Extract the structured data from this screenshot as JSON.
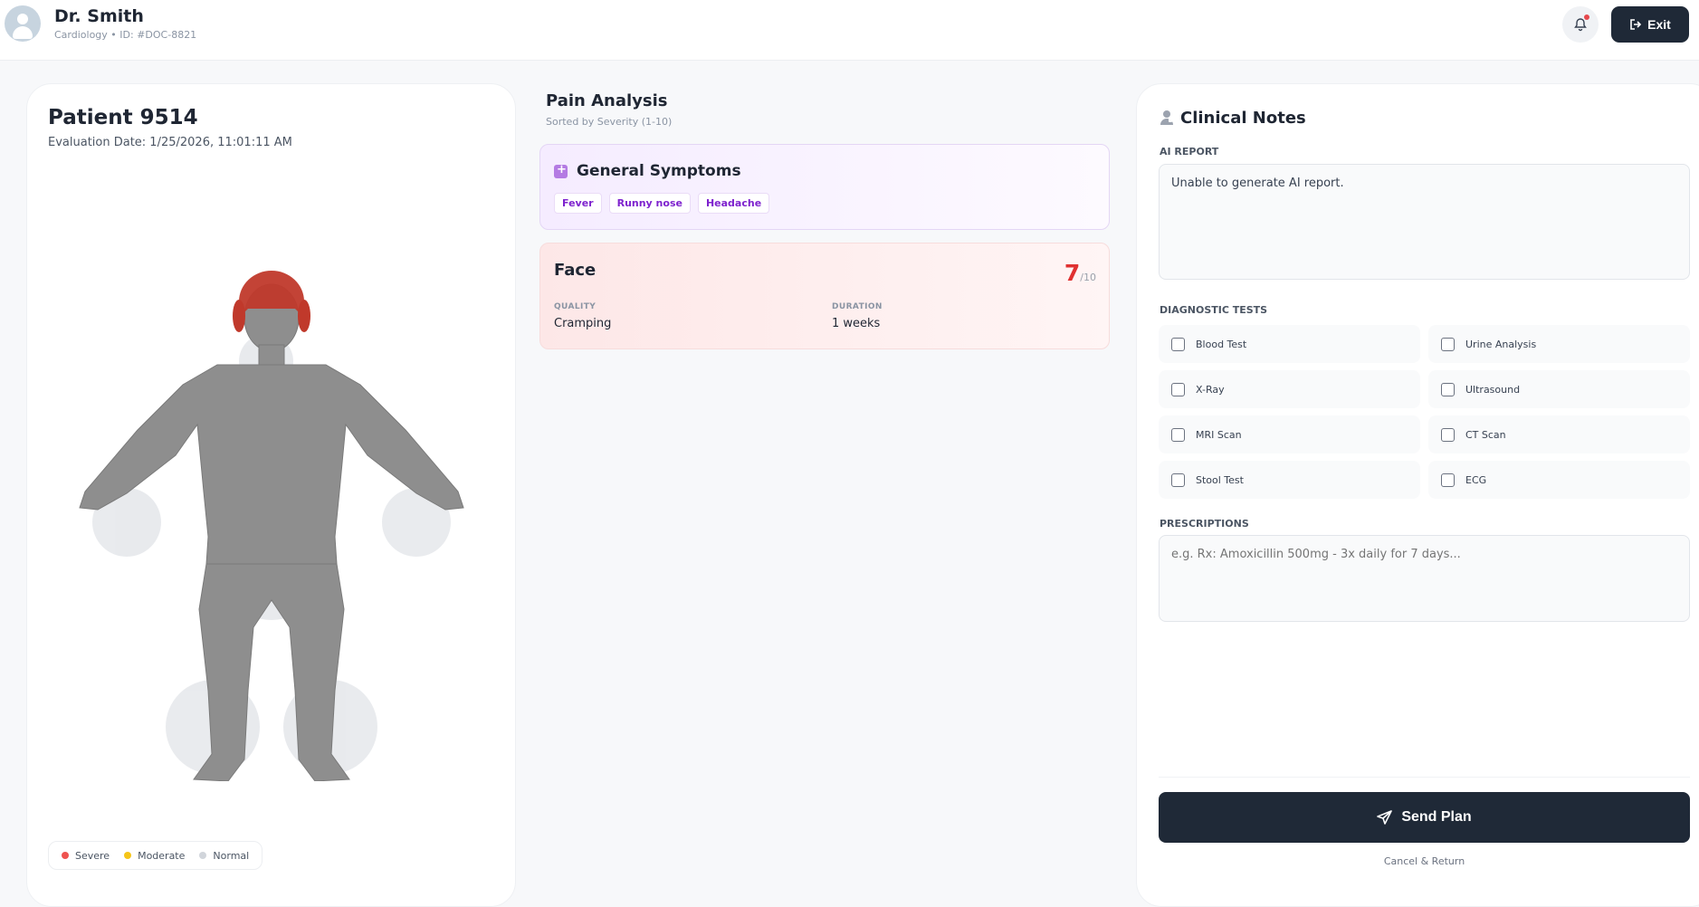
{
  "header": {
    "doctor_name": "Dr. Smith",
    "doctor_subtitle": "Cardiology • ID: #DOC-8821",
    "exit_label": "Exit"
  },
  "patient": {
    "title": "Patient 9514",
    "evaluation_date": "Evaluation Date: 1/25/2026, 11:01:11 AM",
    "legend": [
      {
        "label": "Severe",
        "color": "#ef5350"
      },
      {
        "label": "Moderate",
        "color": "#f5c518"
      },
      {
        "label": "Normal",
        "color": "#d1d5db"
      }
    ],
    "highlight_color": "#c0392b"
  },
  "pain_analysis": {
    "title": "Pain Analysis",
    "subtitle": "Sorted by Severity (1-10)",
    "general": {
      "title": "General Symptoms",
      "tags": [
        "Fever",
        "Runny nose",
        "Headache"
      ]
    },
    "face": {
      "title": "Face",
      "score": "7",
      "score_max": "/10",
      "quality_label": "QUALITY",
      "quality_value": "Cramping",
      "duration_label": "DURATION",
      "duration_value": "1 weeks"
    }
  },
  "clinical_notes": {
    "title": "Clinical Notes",
    "ai_report_label": "AI REPORT",
    "ai_report_text": "Unable to generate AI report.",
    "diagnostic_label": "DIAGNOSTIC TESTS",
    "tests": [
      "Blood Test",
      "Urine Analysis",
      "X-Ray",
      "Ultrasound",
      "MRI Scan",
      "CT Scan",
      "Stool Test",
      "ECG"
    ],
    "prescriptions_label": "PRESCRIPTIONS",
    "prescriptions_placeholder": "e.g. Rx: Amoxicillin 500mg - 3x daily for 7 days...",
    "send_label": "Send Plan",
    "cancel_label": "Cancel & Return"
  }
}
